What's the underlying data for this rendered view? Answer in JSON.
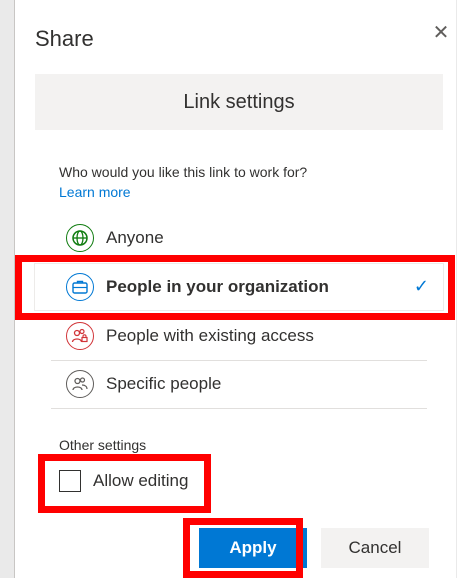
{
  "dialog": {
    "title": "Share",
    "close_glyph": "✕",
    "header": "Link settings",
    "question": "Who would you like this link to work for?",
    "learn_more": "Learn more"
  },
  "options": [
    {
      "label": "Anyone",
      "icon": "globe-icon"
    },
    {
      "label": "People in your organization",
      "icon": "briefcase-icon",
      "selected": true
    },
    {
      "label": "People with existing access",
      "icon": "people-lock-icon"
    },
    {
      "label": "Specific people",
      "icon": "people-icon"
    }
  ],
  "selected_check_glyph": "✓",
  "other_settings": {
    "label": "Other settings",
    "allow_editing": "Allow editing",
    "allow_editing_checked": false
  },
  "buttons": {
    "apply": "Apply",
    "cancel": "Cancel"
  },
  "colors": {
    "accent": "#0078d4",
    "highlight": "#ff0000",
    "anyone_icon": "#107c10",
    "existing_icon": "#d13438"
  }
}
